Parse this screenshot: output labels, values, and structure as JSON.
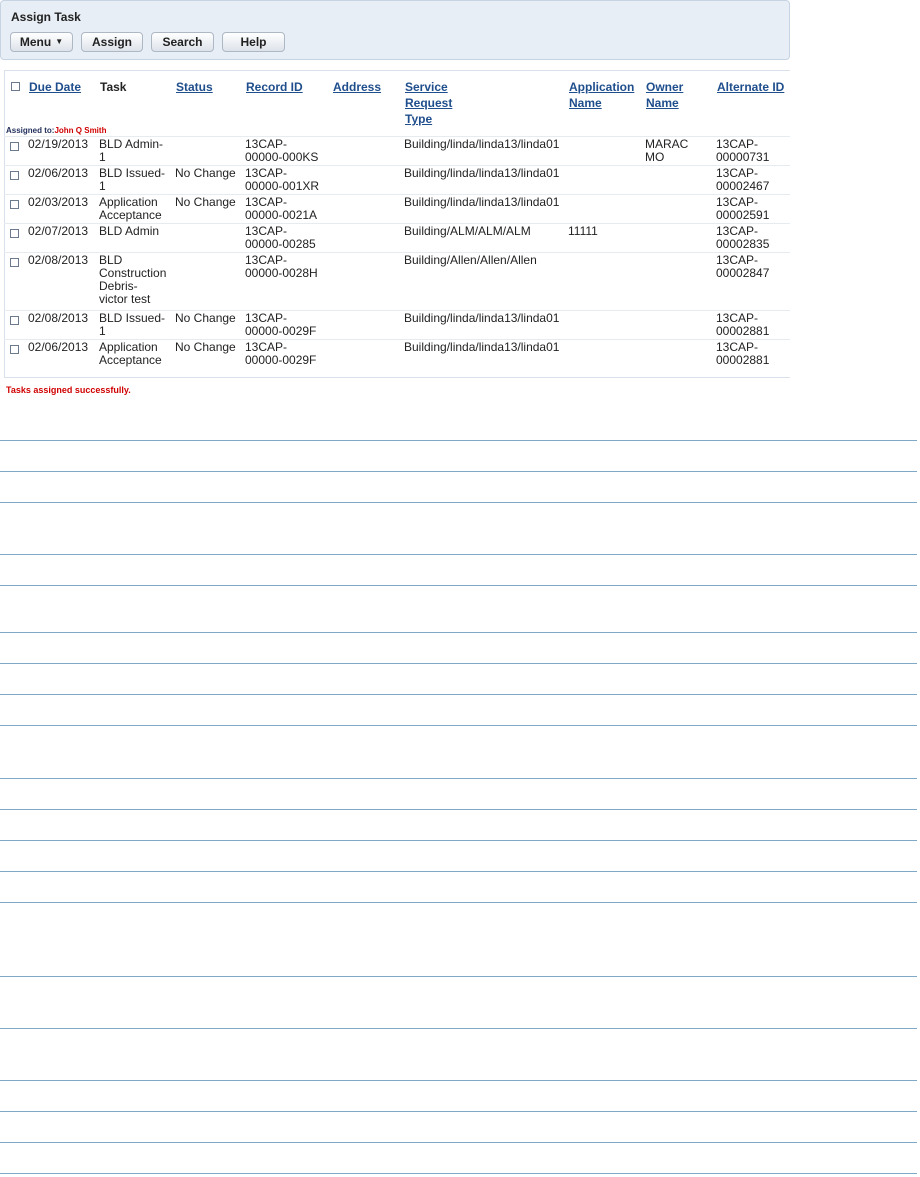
{
  "panel": {
    "title": "Assign Task",
    "buttons": {
      "menu": "Menu",
      "assign": "Assign",
      "search": "Search",
      "help": "Help"
    }
  },
  "columns": {
    "due_date": "Due Date",
    "task": "Task",
    "status": "Status",
    "record_id": "Record ID",
    "address": "Address",
    "service_request_type": "Service\nRequest\nType",
    "application_name": "Application\nName",
    "owner_name": "Owner\nName",
    "alternate_id": "Alternate ID"
  },
  "assigned": {
    "label": "Assigned to:",
    "name": "John Q Smith"
  },
  "rows": [
    {
      "due": "02/19/2013",
      "task": "BLD Admin-\n1",
      "status": "",
      "record": "13CAP-\n00000-000KS",
      "address": "",
      "srt": "Building/linda/linda13/linda01",
      "app": "",
      "owner": "MARAC\nMO",
      "alt": "13CAP-\n00000731"
    },
    {
      "due": "02/06/2013",
      "task": "BLD Issued-\n1",
      "status": "No Change",
      "record": "13CAP-\n00000-001XR",
      "address": "",
      "srt": "Building/linda/linda13/linda01",
      "app": "",
      "owner": "",
      "alt": "13CAP-\n00002467"
    },
    {
      "due": "02/03/2013",
      "task": "Application\nAcceptance",
      "status": "No Change",
      "record": "13CAP-\n00000-0021A",
      "address": "",
      "srt": "Building/linda/linda13/linda01",
      "app": "",
      "owner": "",
      "alt": "13CAP-\n00002591"
    },
    {
      "due": "02/07/2013",
      "task": "BLD Admin",
      "status": "",
      "record": "13CAP-\n00000-00285",
      "address": "",
      "srt": "Building/ALM/ALM/ALM",
      "app": "11111",
      "owner": "",
      "alt": "13CAP-\n00002835"
    },
    {
      "due": "02/08/2013",
      "task": "BLD\nConstruction\nDebris-\nvictor test",
      "status": "",
      "record": "13CAP-\n00000-0028H",
      "address": "",
      "srt": "Building/Allen/Allen/Allen",
      "app": "",
      "owner": "",
      "alt": "13CAP-\n00002847"
    },
    {
      "due": "02/08/2013",
      "task": "BLD Issued-\n1",
      "status": "No Change",
      "record": "13CAP-\n00000-0029F",
      "address": "",
      "srt": "Building/linda/linda13/linda01",
      "app": "",
      "owner": "",
      "alt": "13CAP-\n00002881"
    },
    {
      "due": "02/06/2013",
      "task": "Application\nAcceptance",
      "status": "No Change",
      "record": "13CAP-\n00000-0029F",
      "address": "",
      "srt": "Building/linda/linda13/linda01",
      "app": "",
      "owner": "",
      "alt": "13CAP-\n00002881"
    }
  ],
  "message": "Tasks assigned successfully.",
  "colors": {
    "link": "#1f4e8c",
    "alert": "#d00000",
    "rule": "#7fa9c6",
    "panel": "#e8eef6"
  }
}
